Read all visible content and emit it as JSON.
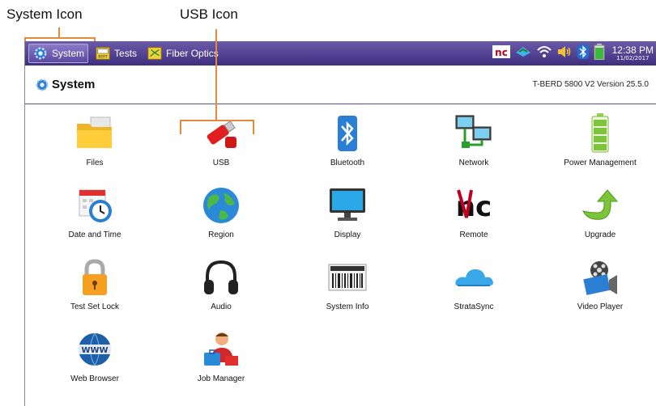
{
  "annotations": {
    "system_icon_label": "System Icon",
    "usb_icon_label": "USB Icon"
  },
  "taskbar": {
    "buttons": [
      {
        "label": "System",
        "icon": "gear-icon",
        "active": true
      },
      {
        "label": "Tests",
        "icon": "bert-icon",
        "active": false
      },
      {
        "label": "Fiber Optics",
        "icon": "fiber-optics-icon",
        "active": false
      }
    ],
    "clock_time": "12:38 PM",
    "clock_date": "11/02/2017",
    "status_icons": [
      "remote-nc-icon",
      "connection-icon",
      "wifi-icon",
      "speaker-icon",
      "bluetooth-icon",
      "battery-icon"
    ]
  },
  "header": {
    "title": "System",
    "version": "T-BERD 5800 V2 Version 25.5.0"
  },
  "apps": [
    {
      "label": "Files",
      "icon": "folder-icon"
    },
    {
      "label": "USB",
      "icon": "usb-drive-icon"
    },
    {
      "label": "Bluetooth",
      "icon": "bluetooth-icon"
    },
    {
      "label": "Network",
      "icon": "network-icon"
    },
    {
      "label": "Power Management",
      "icon": "battery-icon"
    },
    {
      "label": "Date and Time",
      "icon": "calendar-clock-icon"
    },
    {
      "label": "Region",
      "icon": "globe-icon"
    },
    {
      "label": "Display",
      "icon": "monitor-icon"
    },
    {
      "label": "Remote",
      "icon": "remote-nc-icon"
    },
    {
      "label": "Upgrade",
      "icon": "upgrade-arrow-icon"
    },
    {
      "label": "Test Set Lock",
      "icon": "padlock-icon"
    },
    {
      "label": "Audio",
      "icon": "headphones-icon"
    },
    {
      "label": "System Info",
      "icon": "barcode-icon"
    },
    {
      "label": "StrataSync",
      "icon": "cloud-icon"
    },
    {
      "label": "Video Player",
      "icon": "film-reel-icon"
    },
    {
      "label": "Web Browser",
      "icon": "www-globe-icon"
    },
    {
      "label": "Job Manager",
      "icon": "person-briefcase-icon"
    }
  ],
  "colors": {
    "taskbar": "#3f2f80",
    "annotation": "#e38a3b",
    "header_rule": "#5a4a9a"
  }
}
